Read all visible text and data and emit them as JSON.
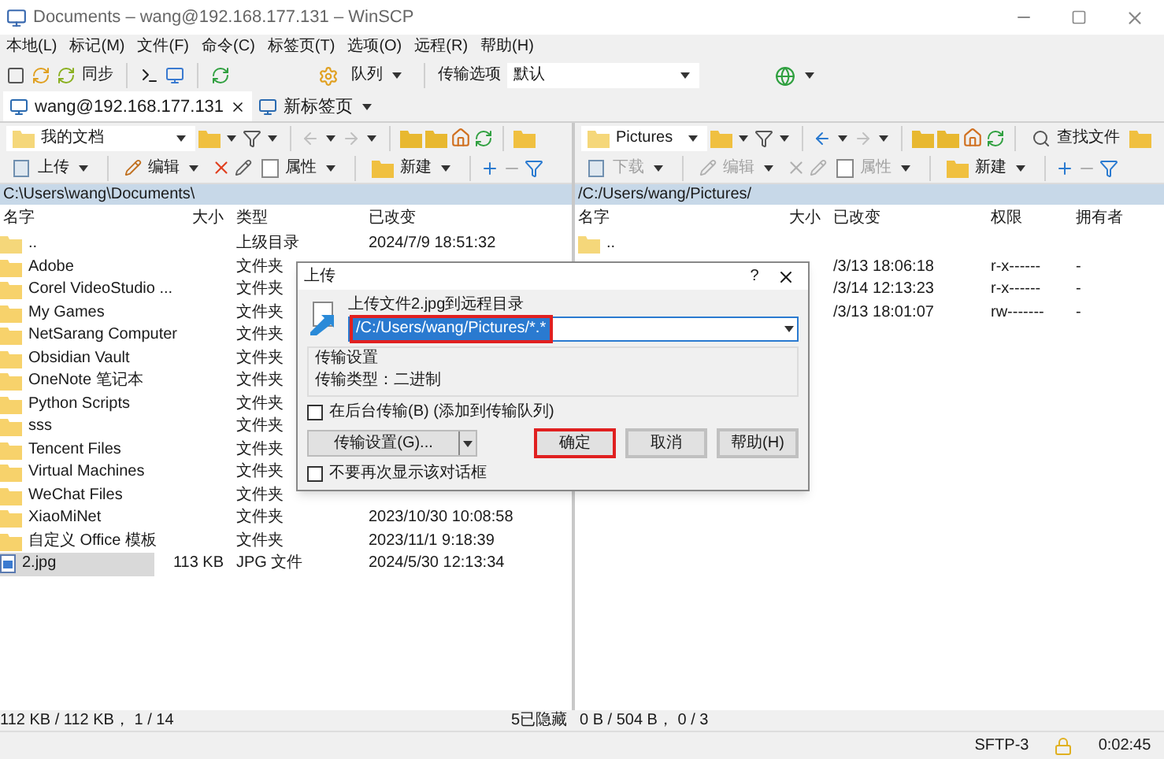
{
  "window": {
    "title": "Documents – wang@192.168.177.131 – WinSCP"
  },
  "menu": [
    "本地(L)",
    "标记(M)",
    "文件(F)",
    "命令(C)",
    "标签页(T)",
    "选项(O)",
    "远程(R)",
    "帮助(H)"
  ],
  "toolbar": {
    "sync_label": "同步",
    "queue_label": "队列",
    "transfer_options_label": "传输选项",
    "transfer_options_value": "默认"
  },
  "tabs": [
    {
      "label": "wang@192.168.177.131",
      "selected": true,
      "kind": "session"
    },
    {
      "label": "新标签页",
      "selected": false,
      "kind": "new"
    }
  ],
  "left_panel": {
    "location": "我的文档",
    "buttons": [
      {
        "label": "上传",
        "disabled": false
      },
      {
        "label": "编辑",
        "disabled": false
      },
      {
        "label": "属性",
        "disabled": false
      },
      {
        "label": "新建",
        "disabled": false
      }
    ],
    "path": "C:\\Users\\wang\\Documents\\",
    "columns": [
      "名字",
      "大小",
      "类型",
      "已改变"
    ],
    "rows": [
      {
        "kind": "parent",
        "name": "..",
        "type": "上级目录",
        "modified": "2024/7/9 18:51:32",
        "selected": false
      },
      {
        "kind": "folder",
        "name": "Adobe",
        "type": "文件夹",
        "selected": false
      },
      {
        "kind": "folder",
        "name": "Corel VideoStudio ...",
        "type": "文件夹",
        "selected": false
      },
      {
        "kind": "folder",
        "name": "My Games",
        "type": "文件夹",
        "selected": false
      },
      {
        "kind": "folder",
        "name": "NetSarang Computer",
        "type": "文件夹",
        "selected": false
      },
      {
        "kind": "folder",
        "name": "Obsidian Vault",
        "type": "文件夹",
        "selected": false
      },
      {
        "kind": "folder",
        "name": "OneNote 笔记本",
        "type": "文件夹",
        "selected": false
      },
      {
        "kind": "folder",
        "name": "Python Scripts",
        "type": "文件夹",
        "selected": false
      },
      {
        "kind": "folder",
        "name": "sss",
        "type": "文件夹",
        "selected": false
      },
      {
        "kind": "folder",
        "name": "Tencent Files",
        "type": "文件夹",
        "selected": false
      },
      {
        "kind": "folder",
        "name": "Virtual Machines",
        "type": "文件夹",
        "selected": false
      },
      {
        "kind": "folder",
        "name": "WeChat Files",
        "type": "文件夹",
        "selected": false
      },
      {
        "kind": "folder",
        "name": "XiaoMiNet",
        "type": "文件夹",
        "modified": "2023/10/30 10:08:58",
        "selected": false
      },
      {
        "kind": "folder",
        "name": "自定义 Office 模板",
        "type": "文件夹",
        "modified": "2023/11/1 9:18:39",
        "selected": false
      },
      {
        "kind": "file",
        "name": "2.jpg",
        "size": "113 KB",
        "type": "JPG 文件",
        "modified": "2024/5/30 12:13:34",
        "selected": true
      }
    ]
  },
  "right_panel": {
    "location": "Pictures",
    "find_label": "查找文件",
    "buttons": [
      {
        "label": "下载",
        "disabled": true
      },
      {
        "label": "编辑",
        "disabled": true
      },
      {
        "label": "属性",
        "disabled": true
      },
      {
        "label": "新建",
        "disabled": false
      }
    ],
    "path": "/C:/Users/wang/Pictures/",
    "columns": [
      "名字",
      "大小",
      "已改变",
      "权限",
      "拥有者"
    ],
    "rows": [
      {
        "kind": "parent",
        "name": ".."
      },
      {
        "kind": "entry",
        "modified": "/3/13 18:06:18",
        "rights": "r-x------",
        "owner": "-"
      },
      {
        "kind": "entry",
        "modified": "/3/14 12:13:23",
        "rights": "r-x------",
        "owner": "-"
      },
      {
        "kind": "entry",
        "modified": "/3/13 18:01:07",
        "rights": "rw-------",
        "owner": "-"
      }
    ]
  },
  "dialog": {
    "title": "上传",
    "help": "?",
    "prompt": "上传文件2.jpg到远程目录",
    "target": "/C:/Users/wang/Pictures/*.*",
    "target_highlighted": true,
    "settings_title": "传输设置",
    "settings_text": "传输类型：二进制",
    "background_checkbox": {
      "label": "在后台传输(B) (添加到传输队列)",
      "checked": false
    },
    "settings_button": "传输设置(G)...",
    "buttons": [
      {
        "label": "确定",
        "highlighted": true
      },
      {
        "label": "取消",
        "highlighted": false
      },
      {
        "label": "帮助(H)",
        "highlighted": false
      }
    ],
    "dont_show_checkbox": {
      "label": "不要再次显示该对话框",
      "checked": false
    }
  },
  "status": {
    "left": "112 KB / 112 KB， 1 / 14",
    "hidden": "5已隐藏",
    "right": "0 B / 504 B， 0 / 3",
    "protocol": "SFTP-3",
    "time": "0:02:45"
  }
}
